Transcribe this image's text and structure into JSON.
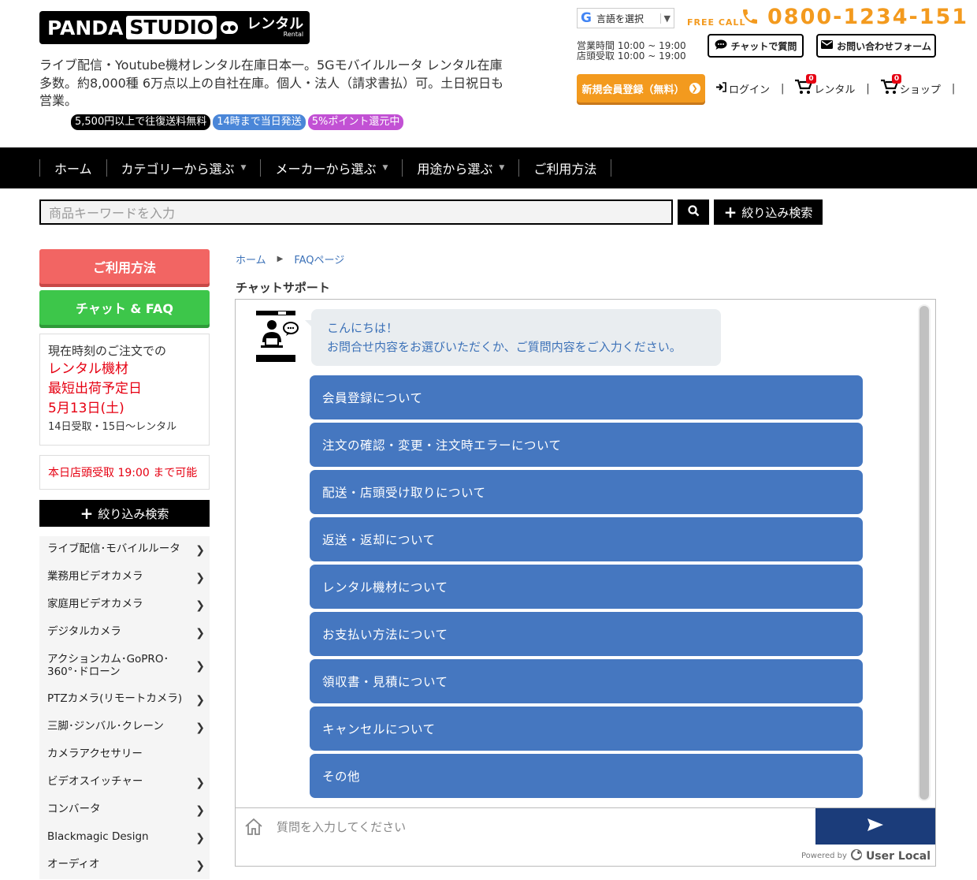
{
  "header": {
    "logo": {
      "brand": "PANDA",
      "studio": "STUDIO",
      "rental": "レンタル",
      "rental_en": "Rental"
    },
    "tagline": "ライブ配信・Youtube機材レンタル在庫日本一。5Gモバイルルータ レンタル在庫多数。約8,000種 6万点以上の自社在庫。個人・法人（請求書払）可。土日祝日も営業。",
    "badges": [
      {
        "text": "5,500円以上で往復送料無料",
        "color": "#000000"
      },
      {
        "text": "14時まで当日発送",
        "color": "#4a86d8"
      },
      {
        "text": "5%ポイント還元中",
        "color": "#c251d4"
      }
    ],
    "language": {
      "g": "G",
      "label": "言語を選択",
      "arrow": "▼"
    },
    "free_call": "FREE CALL",
    "phone": "0800-1234-151",
    "hours": [
      "営業時間 10:00 ~ 19:00",
      "店頭受取 10:00 ~ 19:00"
    ],
    "chat_button": "チャットで質問",
    "contact_button": "お問い合わせフォーム",
    "register_button": "新規会員登録（無料）",
    "login": "ログイン",
    "rental_cart": {
      "label": "レンタル",
      "count": "0"
    },
    "shop_cart": {
      "label": "ショップ",
      "count": "0"
    },
    "accent_color": "#f39a1e"
  },
  "nav": {
    "items": [
      {
        "label": "ホーム",
        "dropdown": false
      },
      {
        "label": "カテゴリーから選ぶ",
        "dropdown": true
      },
      {
        "label": "メーカーから選ぶ",
        "dropdown": true
      },
      {
        "label": "用途から選ぶ",
        "dropdown": true
      },
      {
        "label": "ご利用方法",
        "dropdown": false
      }
    ]
  },
  "search": {
    "placeholder": "商品キーワードを入力",
    "filter_label": "絞り込み検索"
  },
  "sidebar": {
    "usage_button": "ご利用方法",
    "chat_faq_button": "チャット & FAQ",
    "shipping": {
      "line1": "現在時刻のご注文での",
      "line2": "レンタル機材",
      "line3": "最短出荷予定日",
      "line4": "5月13日(土)",
      "line5": "14日受取・15日〜レンタル"
    },
    "store_pickup": "本日店頭受取 19:00 まで可能",
    "filter_label": "絞り込み検索",
    "categories": [
      {
        "label": "ライブ配信･モバイルルータ",
        "chevron": true
      },
      {
        "label": "業務用ビデオカメラ",
        "chevron": true
      },
      {
        "label": "家庭用ビデオカメラ",
        "chevron": true
      },
      {
        "label": "デジタルカメラ",
        "chevron": true
      },
      {
        "label": "アクションカム･GoPRO･360°･ドローン",
        "chevron": true
      },
      {
        "label": "PTZカメラ(リモートカメラ)",
        "chevron": true
      },
      {
        "label": "三脚･ジンバル･クレーン",
        "chevron": true
      },
      {
        "label": "カメラアクセサリー",
        "chevron": false
      },
      {
        "label": "ビデオスイッチャー",
        "chevron": true
      },
      {
        "label": "コンバータ",
        "chevron": true
      },
      {
        "label": "Blackmagic Design",
        "chevron": true
      },
      {
        "label": "オーディオ",
        "chevron": true
      }
    ]
  },
  "breadcrumb": [
    "ホーム",
    "FAQページ"
  ],
  "section_title": "チャットサポート",
  "chat": {
    "avatar_caption": "チャットサポート",
    "greeting_line1": "こんにちは！",
    "greeting_line2": "お問合せ内容をお選びいただくか、ご質問内容をご入力ください。",
    "options": [
      "会員登録について",
      "注文の確認・変更・注文時エラーについて",
      "配送・店頭受け取りについて",
      "返送・返却について",
      "レンタル機材について",
      "お支払い方法について",
      "領収書・見積について",
      "キャンセルについて",
      "その他"
    ],
    "input_placeholder": "質問を入力してください",
    "powered_by": "Powered by",
    "powered_brand": "User Local"
  }
}
